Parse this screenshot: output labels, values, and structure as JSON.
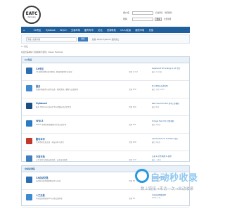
{
  "site": {
    "logo_text": "EATC",
    "logo_sub": "discovery"
  },
  "login": {
    "user_label": "用户名",
    "pass_label": "密码",
    "remember": "自动登录",
    "forgot": "找回密码",
    "login_btn": "登录",
    "register": "立即注册"
  },
  "nav": {
    "items": [
      "首页",
      "CA专区",
      "Hybbook",
      "WQL3",
      "交易市场",
      "酷鸟车市",
      "论坛",
      "资源导航",
      "CA AI交易",
      "服务市场",
      "充值"
    ]
  },
  "search": {
    "placeholder": "请输入搜索内容",
    "button": "搜索",
    "hot": "热搜: WQL3 Hybbook 最新论坛"
  },
  "breadcrumb": "论坛",
  "notice": "欢迎光临本站! 当前版本已更新 | Classic Example",
  "section1": {
    "title": "CA专区"
  },
  "forums": [
    {
      "name": "CA专区",
      "desc": "CA 相关的资讯讨论区域 · 精品资源等汇总信息",
      "stat": "主题 1,212",
      "last": "SuperGold PC Scaling to 1K 专区",
      "last_time": "最后 2小时前",
      "color": "#2a6fb6"
    },
    {
      "name": "服务",
      "desc": "常规问答服务与技术交流 · 相关资源、教程与交流区域",
      "stat": "主题 870",
      "last": "新工单提交方式说明",
      "last_time": "最后 今天 12:40",
      "color": "#3c8ad0"
    },
    {
      "name": "Hybbook",
      "desc": "基于 Hybbook 的电子书与资源分享讨论平台",
      "stat": "主题 540",
      "last": "Best Smart Printer 共享上传教程",
      "last_time": "最后 昨天",
      "color": "#1a4f85"
    },
    {
      "name": "WQL3",
      "desc": "WQL3 全球开发者数据与社区交流专区",
      "stat": "主题 321",
      "last": "Omega Trend 5k 社区更新",
      "last_time": "最后 3天前",
      "color": "#2b7bc4"
    },
    {
      "name": "酷鸟车市",
      "desc": "汽车资讯信息交流 · 车友分享与讨论",
      "stat": "主题 208",
      "last": "upermoded 2.0 Indicator 讨论",
      "last_time": "最后 5天前",
      "color": "#c0392b"
    },
    {
      "name": "交易市场",
      "desc": "二手市场与商品交易信息 · 安全交易指南",
      "stat": "主题 119",
      "last": "交易 & 信用 教程 & 推荐",
      "last_time": "最后 一周前",
      "color": "#3d7fc2"
    }
  ],
  "section2": {
    "title": "交易必读区"
  },
  "forums2": [
    {
      "name": "CA自动交易",
      "desc": "自动化交易系统策略分享与交流",
      "stat": "主题 58",
      "last": "自动化数据报表中心",
      "last_time": "最后 2周前",
      "color": "#2a6fb6"
    },
    {
      "name": "人工交易",
      "desc": "手动交易经验分享与心得交流区域",
      "stat": "主题 44",
      "last": "手动交易策略说明",
      "last_time": "2023-1-15",
      "color": "#3c8ad0"
    }
  ],
  "watermark": {
    "title": "自动秒收录",
    "sub": "数上链接→来访一次→自动收录"
  }
}
